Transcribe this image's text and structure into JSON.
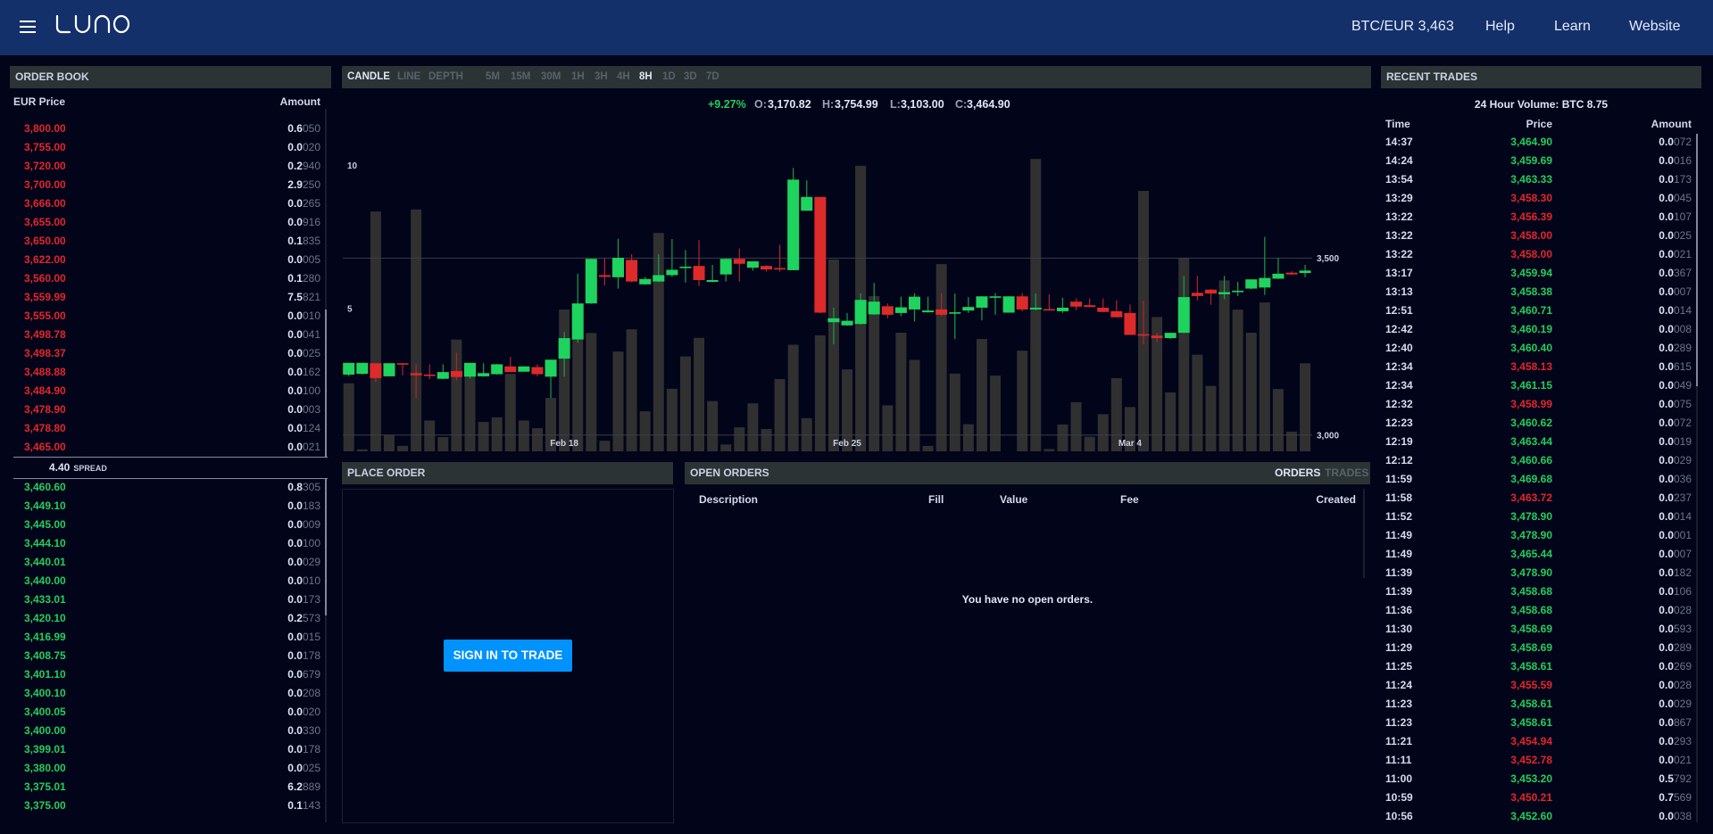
{
  "colors": {
    "background": "#02041a",
    "header": "#13306b",
    "panel_header": "#2c3335",
    "up": "#22cf5c",
    "down": "#e3262c",
    "accent": "#0092ff",
    "candle_up": "#1ed35e",
    "candle_up_wick": "#1a9c47",
    "candle_down": "#dd2a2a",
    "candle_down_wick": "#b3242b",
    "volume_bar": "#303030",
    "grid": "#3b3e48"
  },
  "header": {
    "logo_label": "LUNO",
    "menu_icon": "hamburger-menu-icon",
    "nav": [
      {
        "label": "BTC/EUR 3,463"
      },
      {
        "label": "Help"
      },
      {
        "label": "Learn"
      },
      {
        "label": "Website"
      }
    ]
  },
  "order_book": {
    "title": "ORDER BOOK",
    "columns": {
      "price": "EUR Price",
      "amount": "Amount"
    },
    "asks": [
      {
        "price": "3,800.00",
        "amount": "0.6050"
      },
      {
        "price": "3,755.00",
        "amount": "0.0020"
      },
      {
        "price": "3,720.00",
        "amount": "0.2940"
      },
      {
        "price": "3,700.00",
        "amount": "2.9250"
      },
      {
        "price": "3,666.00",
        "amount": "0.0265"
      },
      {
        "price": "3,655.00",
        "amount": "0.0916"
      },
      {
        "price": "3,650.00",
        "amount": "0.1835"
      },
      {
        "price": "3,622.00",
        "amount": "0.0005"
      },
      {
        "price": "3,560.00",
        "amount": "0.1280"
      },
      {
        "price": "3,559.99",
        "amount": "7.5821"
      },
      {
        "price": "3,555.00",
        "amount": "0.0010"
      },
      {
        "price": "3,498.78",
        "amount": "0.0041"
      },
      {
        "price": "3,498.37",
        "amount": "0.0025"
      },
      {
        "price": "3,488.88",
        "amount": "0.0162"
      },
      {
        "price": "3,484.90",
        "amount": "0.0100"
      },
      {
        "price": "3,478.90",
        "amount": "0.0003"
      },
      {
        "price": "3,478.80",
        "amount": "0.0124"
      },
      {
        "price": "3,465.00",
        "amount": "0.0021"
      }
    ],
    "spread": {
      "value": "4.40",
      "label": "SPREAD"
    },
    "bids": [
      {
        "price": "3,460.60",
        "amount": "0.8305"
      },
      {
        "price": "3,449.10",
        "amount": "0.0183"
      },
      {
        "price": "3,445.00",
        "amount": "0.0009"
      },
      {
        "price": "3,444.10",
        "amount": "0.0100"
      },
      {
        "price": "3,440.01",
        "amount": "0.0029"
      },
      {
        "price": "3,440.00",
        "amount": "0.0010"
      },
      {
        "price": "3,433.01",
        "amount": "0.0173"
      },
      {
        "price": "3,420.10",
        "amount": "0.2573"
      },
      {
        "price": "3,416.99",
        "amount": "0.0015"
      },
      {
        "price": "3,408.75",
        "amount": "0.0178"
      },
      {
        "price": "3,401.10",
        "amount": "0.0679"
      },
      {
        "price": "3,400.10",
        "amount": "0.0208"
      },
      {
        "price": "3,400.05",
        "amount": "0.0020"
      },
      {
        "price": "3,400.00",
        "amount": "0.0330"
      },
      {
        "price": "3,399.01",
        "amount": "0.0178"
      },
      {
        "price": "3,380.00",
        "amount": "0.0025"
      },
      {
        "price": "3,375.01",
        "amount": "6.2889"
      },
      {
        "price": "3,375.00",
        "amount": "0.1143"
      }
    ]
  },
  "chart": {
    "chart_types": [
      {
        "label": "CANDLE",
        "active": true
      },
      {
        "label": "LINE",
        "active": false
      },
      {
        "label": "DEPTH",
        "active": false
      }
    ],
    "intervals": [
      {
        "label": "5M",
        "active": false
      },
      {
        "label": "15M",
        "active": false
      },
      {
        "label": "30M",
        "active": false
      },
      {
        "label": "1H",
        "active": false
      },
      {
        "label": "3H",
        "active": false
      },
      {
        "label": "4H",
        "active": false
      },
      {
        "label": "8H",
        "active": true
      },
      {
        "label": "1D",
        "active": false
      },
      {
        "label": "3D",
        "active": false
      },
      {
        "label": "7D",
        "active": false
      }
    ],
    "ohlc": {
      "change": "+9.27%",
      "open": {
        "label": "O:",
        "value": "3,170.82"
      },
      "high": {
        "label": "H:",
        "value": "3,754.99"
      },
      "low": {
        "label": "L:",
        "value": "3,103.00"
      },
      "close": {
        "label": "C:",
        "value": "3,464.90"
      }
    }
  },
  "chart_data": {
    "type": "candlestick",
    "title": "BTC/EUR",
    "interval": "8H",
    "fields": [
      "open",
      "high",
      "low",
      "close",
      "volume"
    ],
    "ohlcv": [
      [
        3170.82,
        3204,
        3166,
        3204,
        2.38
      ],
      [
        3173,
        3204,
        3171,
        3204,
        0.07
      ],
      [
        3203,
        3203,
        3150,
        3161,
        8.39
      ],
      [
        3166,
        3203,
        3166,
        3203,
        0.57
      ],
      [
        3203,
        3203,
        3169,
        3201,
        0.19
      ],
      [
        3175,
        3200,
        3103,
        3169,
        8.46
      ],
      [
        3171,
        3200,
        3158,
        3167,
        1.08
      ],
      [
        3159,
        3200,
        3158,
        3178,
        0.5
      ],
      [
        3181,
        3233,
        3154,
        3164,
        3.91
      ],
      [
        3165,
        3204,
        3160,
        3204,
        2.61
      ],
      [
        3166,
        3203,
        3165,
        3175,
        1.03
      ],
      [
        3172,
        3201,
        3171,
        3200,
        1.19
      ],
      [
        3194,
        3221,
        3178,
        3178,
        2.71
      ],
      [
        3179,
        3194,
        3179,
        3194,
        1.08
      ],
      [
        3192,
        3200,
        3166,
        3172,
        0.81
      ],
      [
        3165,
        3213,
        3105,
        3213,
        1.87
      ],
      [
        3216,
        3291,
        3165,
        3274,
        4.96
      ],
      [
        3270,
        3456,
        3261,
        3372,
        3.91
      ],
      [
        3372,
        3498,
        3371,
        3498,
        4.14
      ],
      [
        3452,
        3500,
        3423,
        3447,
        0.37
      ],
      [
        3446,
        3555,
        3414,
        3501,
        3.49
      ],
      [
        3495,
        3511,
        3432,
        3434,
        4.27
      ],
      [
        3426,
        3447,
        3425,
        3441,
        1.4
      ],
      [
        3434,
        3511,
        3432,
        3452,
        7.64
      ],
      [
        3452,
        3554,
        3447,
        3467,
        2.19
      ],
      [
        3472,
        3523,
        3431,
        3476,
        3.32
      ],
      [
        3478,
        3551,
        3421,
        3438,
        3.97
      ],
      [
        3433,
        3481,
        3432,
        3438,
        1.76
      ],
      [
        3454,
        3499,
        3434,
        3498,
        0.24
      ],
      [
        3498,
        3527,
        3434,
        3484,
        0.84
      ],
      [
        3473,
        3491,
        3465,
        3491,
        1.68
      ],
      [
        3478,
        3480,
        3462,
        3468,
        0.78
      ],
      [
        3472,
        3538,
        3462,
        3468,
        2.53
      ],
      [
        3466,
        3754.99,
        3466,
        3722,
        3.73
      ],
      [
        3634,
        3720,
        3634,
        3673,
        1.16
      ],
      [
        3673,
        3673,
        3344,
        3346,
        4.06
      ],
      [
        3319,
        3360,
        3256,
        3330,
        6.71
      ],
      [
        3310,
        3345,
        3309,
        3323,
        2.87
      ],
      [
        3314,
        3401,
        3312,
        3382,
        9.99
      ],
      [
        3341,
        3430,
        3340,
        3377,
        5.43
      ],
      [
        3364,
        3372,
        3330,
        3340,
        1.61
      ],
      [
        3345,
        3391,
        3336,
        3361,
        4.15
      ],
      [
        3355,
        3401,
        3321,
        3391,
        3.2
      ],
      [
        3347,
        3391,
        3346,
        3352,
        0.19
      ],
      [
        3355,
        3401,
        3336,
        3340,
        6.55
      ],
      [
        3343,
        3400,
        3271,
        3347,
        2.72
      ],
      [
        3352,
        3390,
        3345,
        3362,
        0.95
      ],
      [
        3360,
        3392,
        3324,
        3392,
        3.93
      ],
      [
        3388,
        3401,
        3340,
        3392,
        2.65
      ],
      [
        3346,
        3392,
        3346,
        3392,
        0
      ],
      [
        3392,
        3401,
        3350,
        3355,
        3.52
      ],
      [
        3355,
        3400,
        3352,
        3360,
        10.23
      ],
      [
        3356,
        3398,
        3353,
        3353,
        0.08
      ],
      [
        3350,
        3388,
        3345,
        3360,
        0.94
      ],
      [
        3377,
        3386,
        3353,
        3363,
        1.72
      ],
      [
        3367,
        3386,
        3361,
        3362,
        0.51
      ],
      [
        3360,
        3386,
        3347,
        3348,
        1.3
      ],
      [
        3350,
        3381,
        3332,
        3333,
        2.56
      ],
      [
        3345,
        3369,
        3283,
        3283,
        1.55
      ],
      [
        3285,
        3380,
        3256,
        3281,
        9.11
      ],
      [
        3281,
        3288,
        3263,
        3274,
        4.7
      ],
      [
        3274,
        3289,
        3272,
        3289,
        2.06
      ],
      [
        3289,
        3450,
        3288,
        3390,
        6.77
      ],
      [
        3402,
        3450,
        3381,
        3393,
        3.38
      ],
      [
        3411,
        3412,
        3368,
        3400,
        2.29
      ],
      [
        3398,
        3450,
        3384,
        3404,
        5.98
      ],
      [
        3404,
        3433,
        3393,
        3408,
        4.96
      ],
      [
        3414,
        3440,
        3412,
        3440,
        4.15
      ],
      [
        3417,
        3560,
        3396,
        3444,
        5.21
      ],
      [
        3442,
        3501,
        3441,
        3456,
        2.18
      ],
      [
        3459,
        3463,
        3453,
        3454,
        0.69
      ],
      [
        3458,
        3481,
        3446,
        3464.9,
        3.08
      ]
    ],
    "x_labels": [
      {
        "index": 16,
        "label": "Feb 18"
      },
      {
        "index": 37,
        "label": "Feb 25"
      },
      {
        "index": 58,
        "label": "Mar 4"
      }
    ],
    "price_ticks": [
      {
        "value": 3500,
        "label": "3,500"
      },
      {
        "value": 3000,
        "label": "3,000"
      }
    ],
    "volume_ticks": [
      {
        "value": 10,
        "label": "10"
      },
      {
        "value": 5,
        "label": "5"
      }
    ],
    "price_range": [
      2954,
      3980
    ],
    "volume_range": [
      0,
      12.7
    ],
    "grid": true,
    "price_axis_position": "right",
    "volume_axis_position": "left"
  },
  "place_order": {
    "title": "PLACE ORDER",
    "sign_in_button": "SIGN IN TO TRADE"
  },
  "open_orders": {
    "title": "OPEN ORDERS",
    "tabs": [
      {
        "label": "ORDERS",
        "active": true
      },
      {
        "label": "TRADES",
        "active": false
      }
    ],
    "columns": {
      "description": "Description",
      "fill": "Fill",
      "value": "Value",
      "fee": "Fee",
      "created": "Created"
    },
    "empty_message": "You have no open orders."
  },
  "recent_trades": {
    "title": "RECENT TRADES",
    "volume_24h": "24 Hour Volume: BTC 8.75",
    "columns": {
      "time": "Time",
      "price": "Price",
      "amount": "Amount"
    },
    "rows": [
      {
        "time": "14:37",
        "price": "3,464.90",
        "amount": "0.0072",
        "direction": "up"
      },
      {
        "time": "14:24",
        "price": "3,459.69",
        "amount": "0.0016",
        "direction": "up"
      },
      {
        "time": "13:54",
        "price": "3,463.33",
        "amount": "0.0173",
        "direction": "up"
      },
      {
        "time": "13:29",
        "price": "3,458.30",
        "amount": "0.0045",
        "direction": "down"
      },
      {
        "time": "13:22",
        "price": "3,456.39",
        "amount": "0.0107",
        "direction": "down"
      },
      {
        "time": "13:22",
        "price": "3,458.00",
        "amount": "0.0025",
        "direction": "down"
      },
      {
        "time": "13:22",
        "price": "3,458.00",
        "amount": "0.0021",
        "direction": "down"
      },
      {
        "time": "13:17",
        "price": "3,459.94",
        "amount": "0.0367",
        "direction": "up"
      },
      {
        "time": "13:13",
        "price": "3,458.38",
        "amount": "0.0007",
        "direction": "up"
      },
      {
        "time": "12:51",
        "price": "3,460.71",
        "amount": "0.0014",
        "direction": "up"
      },
      {
        "time": "12:42",
        "price": "3,460.19",
        "amount": "0.0008",
        "direction": "up"
      },
      {
        "time": "12:40",
        "price": "3,460.40",
        "amount": "0.0289",
        "direction": "up"
      },
      {
        "time": "12:34",
        "price": "3,458.13",
        "amount": "0.0615",
        "direction": "down"
      },
      {
        "time": "12:34",
        "price": "3,461.15",
        "amount": "0.0049",
        "direction": "up"
      },
      {
        "time": "12:32",
        "price": "3,458.99",
        "amount": "0.0075",
        "direction": "down"
      },
      {
        "time": "12:23",
        "price": "3,460.62",
        "amount": "0.0072",
        "direction": "up"
      },
      {
        "time": "12:19",
        "price": "3,463.44",
        "amount": "0.0019",
        "direction": "up"
      },
      {
        "time": "12:12",
        "price": "3,460.66",
        "amount": "0.0029",
        "direction": "up"
      },
      {
        "time": "11:59",
        "price": "3,469.68",
        "amount": "0.0036",
        "direction": "up"
      },
      {
        "time": "11:58",
        "price": "3,463.72",
        "amount": "0.0237",
        "direction": "down"
      },
      {
        "time": "11:52",
        "price": "3,478.90",
        "amount": "0.0014",
        "direction": "up"
      },
      {
        "time": "11:49",
        "price": "3,478.90",
        "amount": "0.0001",
        "direction": "up"
      },
      {
        "time": "11:49",
        "price": "3,465.44",
        "amount": "0.0007",
        "direction": "up"
      },
      {
        "time": "11:39",
        "price": "3,478.90",
        "amount": "0.0182",
        "direction": "up"
      },
      {
        "time": "11:39",
        "price": "3,458.68",
        "amount": "0.0106",
        "direction": "up"
      },
      {
        "time": "11:36",
        "price": "3,458.68",
        "amount": "0.0028",
        "direction": "up"
      },
      {
        "time": "11:30",
        "price": "3,458.69",
        "amount": "0.0593",
        "direction": "up"
      },
      {
        "time": "11:29",
        "price": "3,458.69",
        "amount": "0.0289",
        "direction": "up"
      },
      {
        "time": "11:25",
        "price": "3,458.61",
        "amount": "0.0269",
        "direction": "up"
      },
      {
        "time": "11:24",
        "price": "3,455.59",
        "amount": "0.0028",
        "direction": "down"
      },
      {
        "time": "11:23",
        "price": "3,458.61",
        "amount": "0.0029",
        "direction": "up"
      },
      {
        "time": "11:23",
        "price": "3,458.61",
        "amount": "0.0867",
        "direction": "up"
      },
      {
        "time": "11:21",
        "price": "3,454.94",
        "amount": "0.0293",
        "direction": "down"
      },
      {
        "time": "11:11",
        "price": "3,452.78",
        "amount": "0.0021",
        "direction": "down"
      },
      {
        "time": "11:00",
        "price": "3,453.20",
        "amount": "0.5792",
        "direction": "up"
      },
      {
        "time": "10:59",
        "price": "3,450.21",
        "amount": "0.7569",
        "direction": "down"
      },
      {
        "time": "10:56",
        "price": "3,452.60",
        "amount": "0.0038",
        "direction": "up"
      }
    ]
  }
}
